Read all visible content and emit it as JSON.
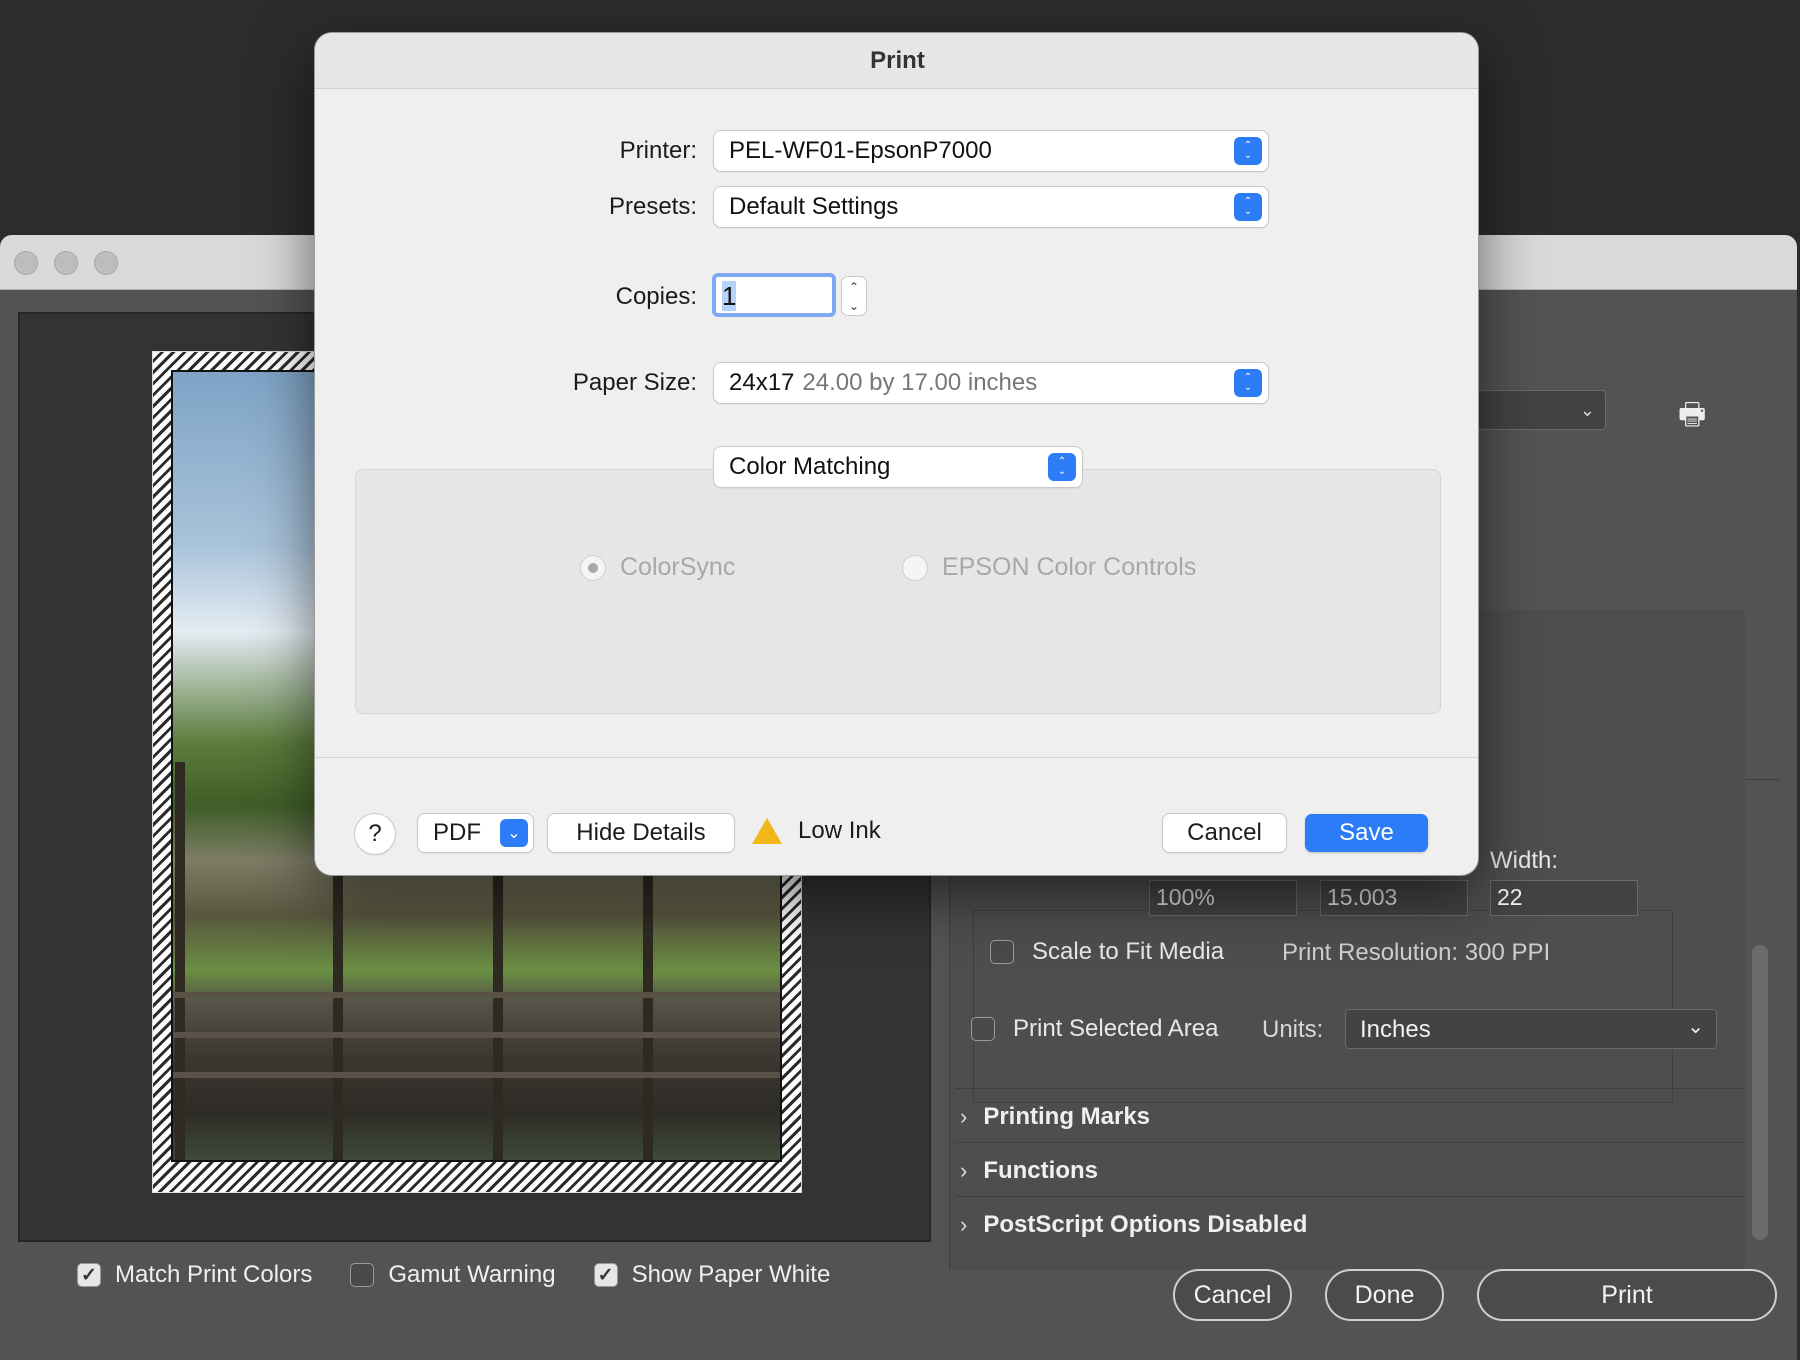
{
  "background_window": {
    "preview_checks": [
      {
        "label": "Match Print Colors",
        "checked": true
      },
      {
        "label": "Gamut Warning",
        "checked": false
      },
      {
        "label": "Show Paper White",
        "checked": true
      }
    ],
    "buttons": {
      "cancel": "Cancel",
      "done": "Done",
      "print": "Print"
    },
    "scale": {
      "width_label": "Width:",
      "scale_value": "100%",
      "height_value": "15.003",
      "width_value": "22"
    },
    "scale_to_fit": {
      "label": "Scale to Fit Media",
      "checked": false
    },
    "print_resolution": "Print Resolution: 300 PPI",
    "print_selected_area": {
      "label": "Print Selected Area",
      "checked": false
    },
    "units": {
      "label": "Units:",
      "value": "Inches"
    },
    "sections": [
      "Printing Marks",
      "Functions",
      "PostScript Options Disabled"
    ]
  },
  "dialog": {
    "title": "Print",
    "printer": {
      "label": "Printer:",
      "value": "PEL-WF01-EpsonP7000"
    },
    "presets": {
      "label": "Presets:",
      "value": "Default Settings"
    },
    "copies": {
      "label": "Copies:",
      "value": "1"
    },
    "paper_size": {
      "label": "Paper Size:",
      "name": "24x17",
      "detail": "24.00 by 17.00 inches"
    },
    "panel": {
      "value": "Color Matching"
    },
    "color_options": [
      {
        "label": "ColorSync",
        "selected": true
      },
      {
        "label": "EPSON Color Controls",
        "selected": false
      }
    ],
    "footer": {
      "help": "?",
      "pdf": "PDF",
      "hide_details": "Hide Details",
      "warning": "Low Ink",
      "cancel": "Cancel",
      "save": "Save"
    },
    "accent_color": "#2b7cf6"
  }
}
